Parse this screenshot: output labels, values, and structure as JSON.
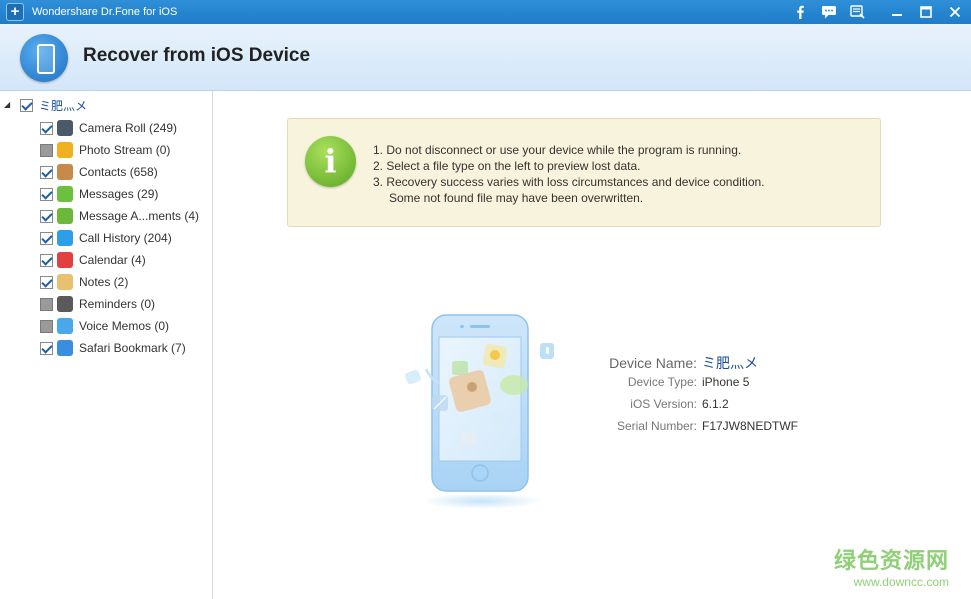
{
  "window": {
    "title": "Wondershare Dr.Fone for iOS"
  },
  "header": {
    "title": "Recover from iOS Device"
  },
  "sidebar": {
    "root": {
      "label": "ミ肥灬メ",
      "checked": true
    },
    "items": [
      {
        "label": "Camera Roll (249)",
        "checked": true,
        "icon": "camera-roll-icon",
        "color": "#4a5a6a"
      },
      {
        "label": "Photo Stream (0)",
        "checked": false,
        "icon": "photo-stream-icon",
        "color": "#f0b020"
      },
      {
        "label": "Contacts (658)",
        "checked": true,
        "icon": "contacts-icon",
        "color": "#c88a4a"
      },
      {
        "label": "Messages (29)",
        "checked": true,
        "icon": "messages-icon",
        "color": "#6cc040"
      },
      {
        "label": "Message A...ments (4)",
        "checked": true,
        "icon": "message-attachments-icon",
        "color": "#6cb83a"
      },
      {
        "label": "Call History (204)",
        "checked": true,
        "icon": "call-history-icon",
        "color": "#2f9ee8"
      },
      {
        "label": "Calendar (4)",
        "checked": true,
        "icon": "calendar-icon",
        "color": "#e04040"
      },
      {
        "label": "Notes (2)",
        "checked": true,
        "icon": "notes-icon",
        "color": "#e8c070"
      },
      {
        "label": "Reminders (0)",
        "checked": false,
        "icon": "reminders-icon",
        "color": "#5a5a5a"
      },
      {
        "label": "Voice Memos (0)",
        "checked": false,
        "icon": "voice-memos-icon",
        "color": "#49a8e8"
      },
      {
        "label": "Safari Bookmark (7)",
        "checked": true,
        "icon": "safari-bookmark-icon",
        "color": "#3a8ee0"
      }
    ]
  },
  "tips": {
    "lines": [
      "1. Do not disconnect or use your device while the program is running.",
      "2. Select a file type on the left to preview lost data.",
      "3. Recovery success varies with loss circumstances and device condition.",
      "Some not found file may have been overwritten."
    ]
  },
  "device": {
    "name_label": "Device Name:",
    "name_value": "ミ肥灬メ",
    "type_label": "Device Type:",
    "type_value": "iPhone 5",
    "version_label": "iOS Version:",
    "version_value": "6.1.2",
    "serial_label": "Serial Number:",
    "serial_value": "F17JW8NEDTWF"
  },
  "watermark": {
    "cn": "绿色资源网",
    "url": "www.downcc.com"
  },
  "colors": {
    "titlebar": "#2f8fd8",
    "header_bg": "#dceafa",
    "tip_bg": "#f8f3dc",
    "accent_text": "#1a4f9c"
  }
}
